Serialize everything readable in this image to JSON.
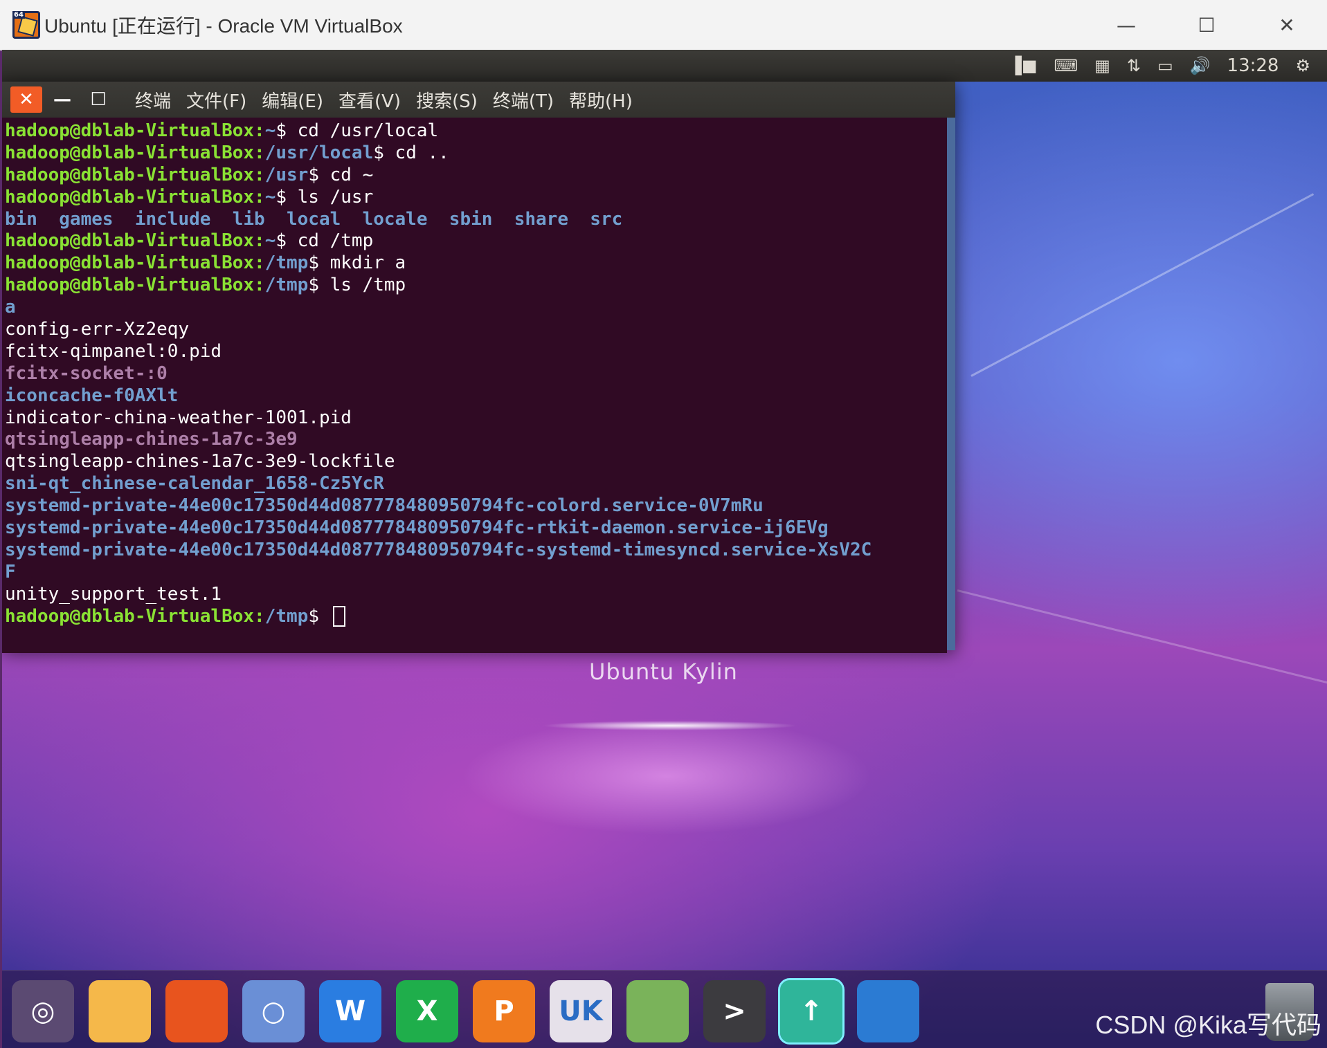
{
  "host_window": {
    "title": "Ubuntu [正在运行] - Oracle VM VirtualBox",
    "badge": "64",
    "controls": {
      "minimize": "—",
      "maximize": "☐",
      "close": "✕"
    }
  },
  "top_panel": {
    "indicators": [
      "network-icon",
      "keyboard-icon",
      "calendar-icon",
      "transfer-icon",
      "battery-icon",
      "volume-icon"
    ],
    "clock": "13:28"
  },
  "terminal": {
    "buttons": {
      "close": "✕",
      "minimize": "—",
      "maximize": "☐"
    },
    "menu": [
      "终端",
      "文件(F)",
      "编辑(E)",
      "查看(V)",
      "搜索(S)",
      "终端(T)",
      "帮助(H)"
    ],
    "prompt_user": "hadoop@dblab-VirtualBox",
    "lines": [
      {
        "path": "~",
        "cmd": " cd /usr/local"
      },
      {
        "path": "/usr/local",
        "cmd": " cd .."
      },
      {
        "path": "/usr",
        "cmd": " cd ~"
      },
      {
        "path": "~",
        "cmd": " ls /usr"
      },
      {
        "listing": "bin  games  include  lib  local  locale  sbin  share  src"
      },
      {
        "path": "~",
        "cmd": " cd /tmp"
      },
      {
        "path": "/tmp",
        "cmd": " mkdir a"
      },
      {
        "path": "/tmp",
        "cmd": " ls /tmp"
      }
    ],
    "output": [
      {
        "text": "a",
        "kind": "dir"
      },
      {
        "text": "config-err-Xz2eqy",
        "kind": "plain"
      },
      {
        "text": "fcitx-qimpanel:0.pid",
        "kind": "plain"
      },
      {
        "text": "fcitx-socket-:0",
        "kind": "sock"
      },
      {
        "text": "iconcache-f0AXlt",
        "kind": "dir"
      },
      {
        "text": "indicator-china-weather-1001.pid",
        "kind": "plain"
      },
      {
        "text": "qtsingleapp-chines-1a7c-3e9",
        "kind": "sock"
      },
      {
        "text": "qtsingleapp-chines-1a7c-3e9-lockfile",
        "kind": "plain"
      },
      {
        "text": "sni-qt_chinese-calendar_1658-Cz5YcR",
        "kind": "dir"
      },
      {
        "text": "systemd-private-44e00c17350d44d087778480950794fc-colord.service-0V7mRu",
        "kind": "dir"
      },
      {
        "text": "systemd-private-44e00c17350d44d087778480950794fc-rtkit-daemon.service-ij6EVg",
        "kind": "dir"
      },
      {
        "text": "systemd-private-44e00c17350d44d087778480950794fc-systemd-timesyncd.service-XsV2C",
        "kind": "dir"
      },
      {
        "text": "F",
        "kind": "dir"
      },
      {
        "text": "unity_support_test.1",
        "kind": "plain"
      }
    ],
    "final_prompt_path": "/tmp"
  },
  "wallpaper_title": "Ubuntu Kylin",
  "dock": {
    "items": [
      {
        "name": "ubuntu-kylin-dash-icon",
        "glyph": "◎",
        "bg": "#5b4a72"
      },
      {
        "name": "files-folder-icon",
        "glyph": "",
        "bg": "#f5b84a"
      },
      {
        "name": "firefox-icon",
        "glyph": "",
        "bg": "#e8541e"
      },
      {
        "name": "chromium-icon",
        "glyph": "○",
        "bg": "#6a8fd6"
      },
      {
        "name": "wps-writer-icon",
        "glyph": "W",
        "bg": "#2a7de1"
      },
      {
        "name": "wps-spreadsheet-icon",
        "glyph": "X",
        "bg": "#1fae4b"
      },
      {
        "name": "wps-presentation-icon",
        "glyph": "P",
        "bg": "#f07a1e"
      },
      {
        "name": "software-center-icon",
        "glyph": "UK",
        "bg": "#e6e1ea"
      },
      {
        "name": "kylin-assistant-icon",
        "glyph": "",
        "bg": "#7ab35a"
      },
      {
        "name": "terminal-icon",
        "glyph": ">",
        "bg": "#3c3b3f"
      },
      {
        "name": "kylin-update-icon",
        "glyph": "↑",
        "bg": "#2fb59a"
      },
      {
        "name": "workspace-switcher-icon",
        "glyph": "",
        "bg": "#2b7bd3"
      }
    ]
  },
  "watermark": "CSDN @Kika写代码"
}
